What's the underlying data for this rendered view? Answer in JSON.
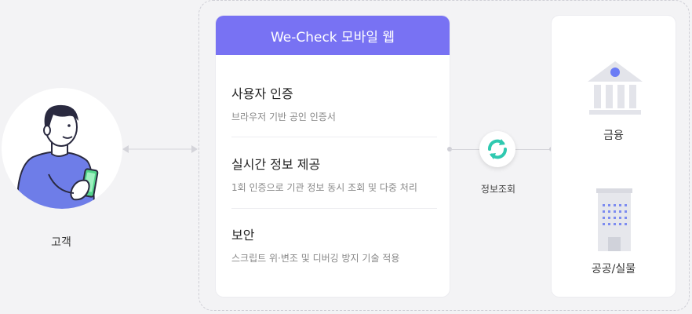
{
  "customer": {
    "label": "고객"
  },
  "mobile_web": {
    "title": "We-Check 모바일 웹",
    "features": [
      {
        "title": "사용자 인증",
        "desc": "브라우저 기반 공인 인증서"
      },
      {
        "title": "실시간 정보 제공",
        "desc": "1회 인증으로 기관 정보 동시 조회 및 다중 처리"
      },
      {
        "title": "보안",
        "desc": "스크립트 위·변조 및 디버깅 방지 기술 적용"
      }
    ]
  },
  "sync": {
    "label": "정보조회"
  },
  "institutions": [
    {
      "label": "금융",
      "icon": "bank-icon"
    },
    {
      "label": "공공/실물",
      "icon": "building-icon"
    }
  ],
  "colors": {
    "accent": "#7872f3",
    "sync_teal": "#2fc9b0",
    "bank_dot": "#6b7cf5",
    "figure_sweater": "#6e7de8",
    "phone": "#52d48a"
  }
}
